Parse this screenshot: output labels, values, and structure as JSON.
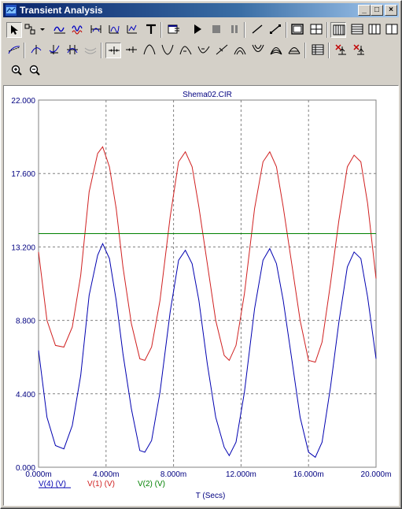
{
  "window": {
    "title": "Transient Analysis"
  },
  "titlebar_buttons": {
    "minimize": "_",
    "maximize": "□",
    "close": "×"
  },
  "toolbar": {
    "row1": [
      "pointer-tool",
      "select-box-tool",
      "wave-cursor-tool",
      "waveform-1-tool",
      "waveform-2-tool",
      "waveform-3-tool",
      "waveform-4-tool",
      "text-tool",
      "properties-tool",
      "run-button",
      "stop-button",
      "pause-button",
      "line-tool",
      "line-points-tool",
      "grid-1-tool",
      "grid-2-tool",
      "grid-3-tool",
      "grid-4-tool",
      "grid-5-tool",
      "grid-6-tool"
    ],
    "row2": [
      "tangent-tool",
      "cursor-left-tool",
      "cursor-right-tool",
      "cursor-peak-tool",
      "cursor-valley-tool",
      "cursor-move-left-tool",
      "cursor-move-right-tool",
      "peak-tool",
      "valley-tool",
      "high-tool",
      "low-tool",
      "inflection-tool",
      "global-high-tool",
      "global-low-tool",
      "top-tool",
      "bottom-tool",
      "table-tool",
      "delete-cursor-tool",
      "cursor-select-tool"
    ],
    "row3": [
      "zoom-in-button",
      "zoom-out-button"
    ]
  },
  "chart_data": {
    "type": "line",
    "title": "Shema02.CIR",
    "xlabel": "T (Secs)",
    "ylabel": "",
    "xlim": [
      0,
      20
    ],
    "ylim": [
      0,
      22
    ],
    "x_unit": "m",
    "x_ticks": [
      "0.000m",
      "4.000m",
      "8.000m",
      "12.000m",
      "16.000m",
      "20.000m"
    ],
    "y_ticks": [
      "0.000",
      "4.400",
      "8.800",
      "13.200",
      "17.600",
      "22.000"
    ],
    "grid": true,
    "legend_placement": "bottom-left",
    "series": [
      {
        "name": "V(4) (V)",
        "color": "#0000b0",
        "points": [
          [
            0,
            7.0
          ],
          [
            0.5,
            3.0
          ],
          [
            1.0,
            1.3
          ],
          [
            1.5,
            1.1
          ],
          [
            2.0,
            2.5
          ],
          [
            2.5,
            5.5
          ],
          [
            3.0,
            10.3
          ],
          [
            3.5,
            12.7
          ],
          [
            3.8,
            13.4
          ],
          [
            4.2,
            12.5
          ],
          [
            4.6,
            10.0
          ],
          [
            5.0,
            6.8
          ],
          [
            5.5,
            3.5
          ],
          [
            6.0,
            1.0
          ],
          [
            6.3,
            0.9
          ],
          [
            6.7,
            1.6
          ],
          [
            7.2,
            4.5
          ],
          [
            7.8,
            9.3
          ],
          [
            8.3,
            12.4
          ],
          [
            8.7,
            13.0
          ],
          [
            9.1,
            12.2
          ],
          [
            9.5,
            10.0
          ],
          [
            10.0,
            6.2
          ],
          [
            10.5,
            3.0
          ],
          [
            11.0,
            1.2
          ],
          [
            11.3,
            0.7
          ],
          [
            11.7,
            1.5
          ],
          [
            12.2,
            4.5
          ],
          [
            12.8,
            9.5
          ],
          [
            13.3,
            12.4
          ],
          [
            13.7,
            13.1
          ],
          [
            14.1,
            12.2
          ],
          [
            14.5,
            10.0
          ],
          [
            15.0,
            6.5
          ],
          [
            15.5,
            3.0
          ],
          [
            16.0,
            0.9
          ],
          [
            16.4,
            0.6
          ],
          [
            16.8,
            1.5
          ],
          [
            17.3,
            4.8
          ],
          [
            17.8,
            8.7
          ],
          [
            18.3,
            12.0
          ],
          [
            18.7,
            12.9
          ],
          [
            19.1,
            12.5
          ],
          [
            19.5,
            10.2
          ],
          [
            20.0,
            6.5
          ]
        ]
      },
      {
        "name": "V(1) (V)",
        "color": "#d02020",
        "points": [
          [
            0,
            12.9
          ],
          [
            0.5,
            8.8
          ],
          [
            1.0,
            7.3
          ],
          [
            1.5,
            7.2
          ],
          [
            2.0,
            8.4
          ],
          [
            2.5,
            11.5
          ],
          [
            3.0,
            16.5
          ],
          [
            3.5,
            18.8
          ],
          [
            3.8,
            19.2
          ],
          [
            4.2,
            18.0
          ],
          [
            4.6,
            15.5
          ],
          [
            5.0,
            12.0
          ],
          [
            5.5,
            8.6
          ],
          [
            6.0,
            6.5
          ],
          [
            6.3,
            6.4
          ],
          [
            6.7,
            7.2
          ],
          [
            7.2,
            10.0
          ],
          [
            7.8,
            15.0
          ],
          [
            8.3,
            18.3
          ],
          [
            8.7,
            18.9
          ],
          [
            9.1,
            18.0
          ],
          [
            9.5,
            15.6
          ],
          [
            10.0,
            12.2
          ],
          [
            10.5,
            8.8
          ],
          [
            11.0,
            6.7
          ],
          [
            11.3,
            6.4
          ],
          [
            11.7,
            7.3
          ],
          [
            12.2,
            10.4
          ],
          [
            12.8,
            15.5
          ],
          [
            13.3,
            18.3
          ],
          [
            13.7,
            18.9
          ],
          [
            14.1,
            18.0
          ],
          [
            14.5,
            15.6
          ],
          [
            15.0,
            12.2
          ],
          [
            15.5,
            8.8
          ],
          [
            16.0,
            6.4
          ],
          [
            16.4,
            6.3
          ],
          [
            16.8,
            7.5
          ],
          [
            17.3,
            11.0
          ],
          [
            17.8,
            14.8
          ],
          [
            18.3,
            18.0
          ],
          [
            18.7,
            18.7
          ],
          [
            19.1,
            18.3
          ],
          [
            19.5,
            15.8
          ],
          [
            20.0,
            11.3
          ]
        ]
      },
      {
        "name": "V(2) (V)",
        "color": "#008000",
        "points": [
          [
            0,
            14.0
          ],
          [
            20,
            14.0
          ]
        ]
      }
    ]
  }
}
